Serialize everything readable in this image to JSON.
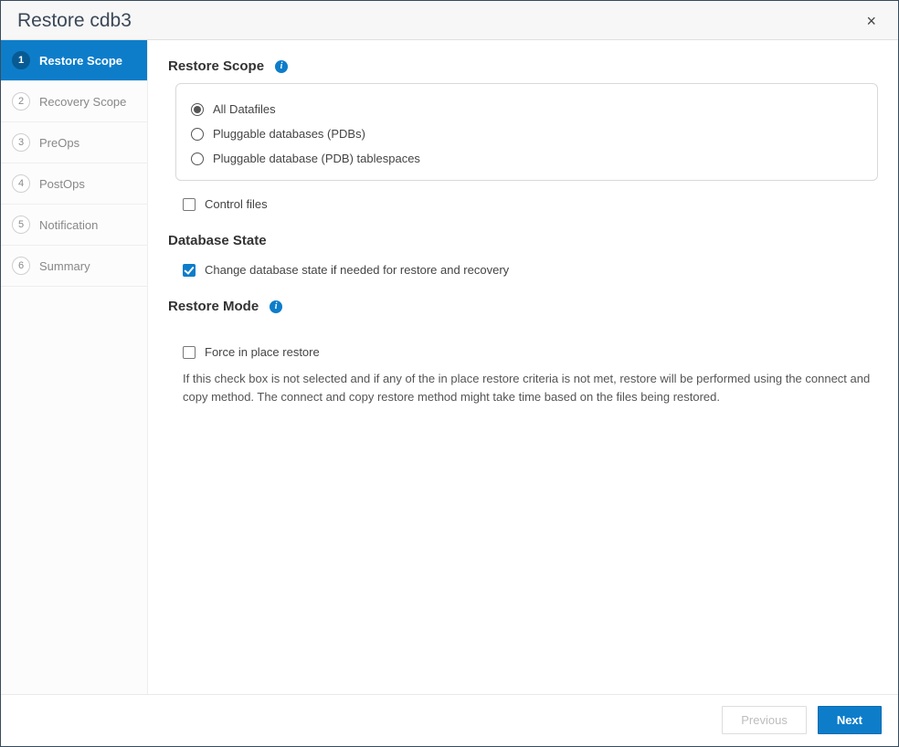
{
  "header": {
    "title": "Restore cdb3",
    "close": "×"
  },
  "steps": [
    {
      "num": "1",
      "label": "Restore Scope",
      "active": true
    },
    {
      "num": "2",
      "label": "Recovery Scope",
      "active": false
    },
    {
      "num": "3",
      "label": "PreOps",
      "active": false
    },
    {
      "num": "4",
      "label": "PostOps",
      "active": false
    },
    {
      "num": "5",
      "label": "Notification",
      "active": false
    },
    {
      "num": "6",
      "label": "Summary",
      "active": false
    }
  ],
  "restoreScope": {
    "title": "Restore Scope",
    "options": {
      "allDatafiles": "All Datafiles",
      "pdbs": "Pluggable databases (PDBs)",
      "pdbTablespaces": "Pluggable database (PDB) tablespaces"
    },
    "selected": "allDatafiles",
    "controlFiles": {
      "label": "Control files",
      "checked": false
    }
  },
  "databaseState": {
    "title": "Database State",
    "changeState": {
      "label": "Change database state if needed for restore and recovery",
      "checked": true
    }
  },
  "restoreMode": {
    "title": "Restore Mode",
    "forceInPlace": {
      "label": "Force in place restore",
      "checked": false
    },
    "helpText": "If this check box is not selected and if any of the in place restore criteria is not met, restore will be performed using the connect and copy method. The connect and copy restore method might take time based on the files being restored."
  },
  "footer": {
    "previous": "Previous",
    "next": "Next"
  }
}
